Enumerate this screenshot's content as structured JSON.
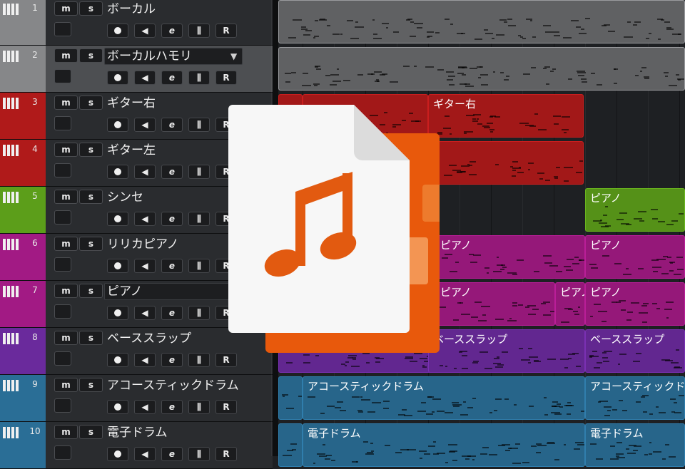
{
  "colors": {
    "vocal": "#868789",
    "guitar": "#b01a1a",
    "synth": "#5c9e1a",
    "piano": "#a21a84",
    "bass": "#6a2a9c",
    "drums": "#2a6e96",
    "file_front": "#f7f7f7",
    "file_back": "#e8590c",
    "note": "#e25a10"
  },
  "track_controls": {
    "mute": "m",
    "solo": "s",
    "edit": "e",
    "read": "R",
    "mixer_glyph": "⫼",
    "speaker_glyph": "◀",
    "dropdown_glyph": "▼"
  },
  "tracks": [
    {
      "number": "1",
      "name": "ボーカル",
      "color_key": "vocal",
      "selected": false,
      "has_dropdown": false
    },
    {
      "number": "2",
      "name": "ボーカルハモリ",
      "color_key": "vocal",
      "selected": true,
      "has_dropdown": true
    },
    {
      "number": "3",
      "name": "ギター右",
      "color_key": "guitar",
      "selected": false,
      "has_dropdown": false
    },
    {
      "number": "4",
      "name": "ギター左",
      "color_key": "guitar",
      "selected": false,
      "has_dropdown": false
    },
    {
      "number": "5",
      "name": "シンセ",
      "color_key": "synth",
      "selected": false,
      "has_dropdown": false
    },
    {
      "number": "6",
      "name": "リリカピアノ",
      "color_key": "piano",
      "selected": false,
      "has_dropdown": false
    },
    {
      "number": "7",
      "name": "ピアノ",
      "color_key": "piano",
      "selected": false,
      "has_dropdown": true
    },
    {
      "number": "8",
      "name": "ベーススラップ",
      "color_key": "bass",
      "selected": false,
      "has_dropdown": false
    },
    {
      "number": "9",
      "name": "アコースティックドラム",
      "color_key": "drums",
      "selected": false,
      "has_dropdown": false
    },
    {
      "number": "10",
      "name": "電子ドラム",
      "color_key": "drums",
      "selected": false,
      "has_dropdown": false
    }
  ],
  "clip_labels": {
    "guitar_right": "ギター右",
    "synth": "ピアノ",
    "piano": "ピアノ",
    "bass": "ベーススラップ",
    "acoustic_drums": "アコースティックドラム",
    "electronic_drums": "電子ドラム"
  }
}
